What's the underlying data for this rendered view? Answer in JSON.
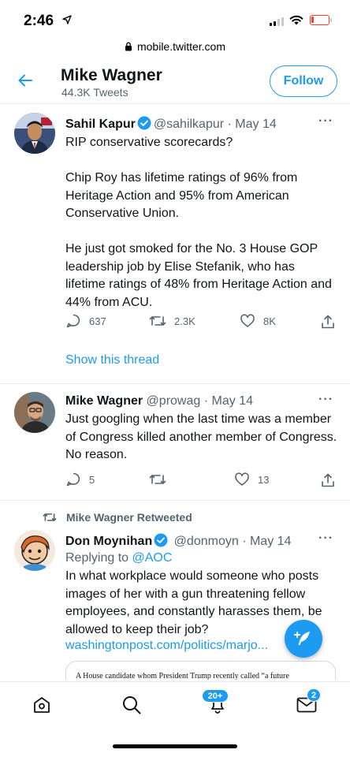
{
  "status_bar": {
    "time": "2:46"
  },
  "browser": {
    "url": "mobile.twitter.com"
  },
  "profile": {
    "name": "Mike Wagner",
    "tweet_count": "44.3K Tweets",
    "follow_label": "Follow"
  },
  "tweets": [
    {
      "name": "Sahil Kapur",
      "handle": "@sahilkapur",
      "date": "· May 14",
      "text": "RIP conservative scorecards?\n\nChip Roy has lifetime ratings of 96% from Heritage Action and 95% from American Conservative Union.\n\nHe just got smoked for the No. 3 House GOP leadership job by Elise Stefanik, who has lifetime ratings of 48% from Heritage Action and 44% from ACU.",
      "replies": "637",
      "retweets": "2.3K",
      "likes": "8K",
      "show_thread": "Show this thread"
    },
    {
      "name": "Mike Wagner",
      "handle": "@prowag",
      "date": "· May 14",
      "text": "Just googling when the last time was a member of Congress killed another member of Congress. No reason.",
      "replies": "5",
      "retweets": "",
      "likes": "13"
    },
    {
      "retweeted_by": "Mike Wagner Retweeted",
      "name": "Don Moynihan",
      "handle": "@donmoyn",
      "date": "· May 14",
      "replying_prefix": "Replying to",
      "replying_to": "@AOC",
      "text": "In what workplace would someone who posts images of her with a gun threatening fellow employees, and constantly harasses them, be allowed to keep their job?",
      "link": "washingtonpost.com/politics/marjo...",
      "card_text": "A House candidate whom President Trump recently called “a future"
    }
  ],
  "nav": {
    "notifications_badge": "20+",
    "messages_badge": "2"
  },
  "colors": {
    "accent": "#1d9bf0",
    "text": "#0f1419",
    "secondary": "#536471"
  }
}
